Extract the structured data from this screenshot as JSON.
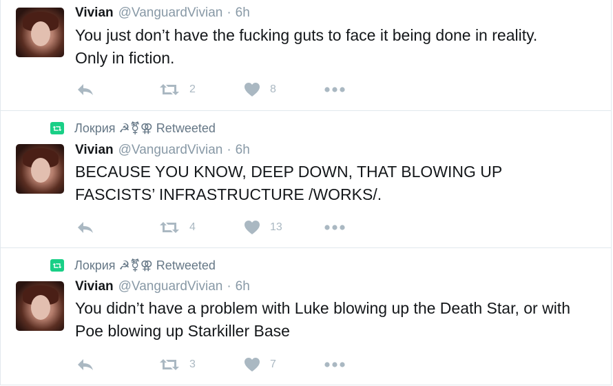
{
  "colors": {
    "retweet_badge": "#19cf86",
    "icon_gray": "#aab8c2",
    "meta_gray": "#8899a6",
    "text": "#14171a",
    "divider": "#e1e8ed"
  },
  "icons": {
    "reply": "reply-icon",
    "retweet": "retweet-icon",
    "like": "heart-icon",
    "more": "more-dots-icon"
  },
  "tweets": [
    {
      "retweet_context": "",
      "name": "Vivian",
      "handle": "@VanguardVivian",
      "separator": "·",
      "time": "6h",
      "text": "You just don’t have the fucking guts to face it being done in reality.\nOnly in fiction.",
      "retweets": "2",
      "likes": "8"
    },
    {
      "retweet_context": "Локрия ☭⚧⚢ Retweeted",
      "name": "Vivian",
      "handle": "@VanguardVivian",
      "separator": "·",
      "time": "6h",
      "text": "BECAUSE YOU KNOW, DEEP DOWN, THAT BLOWING UP\nFASCISTS’ INFRASTRUCTURE /WORKS/.",
      "retweets": "4",
      "likes": "13"
    },
    {
      "retweet_context": "Локрия ☭⚧⚢ Retweeted",
      "name": "Vivian",
      "handle": "@VanguardVivian",
      "separator": "·",
      "time": "6h",
      "text": "You didn’t have a problem with Luke blowing up the Death Star, or with\nPoe blowing up Starkiller Base",
      "retweets": "3",
      "likes": "7"
    }
  ]
}
